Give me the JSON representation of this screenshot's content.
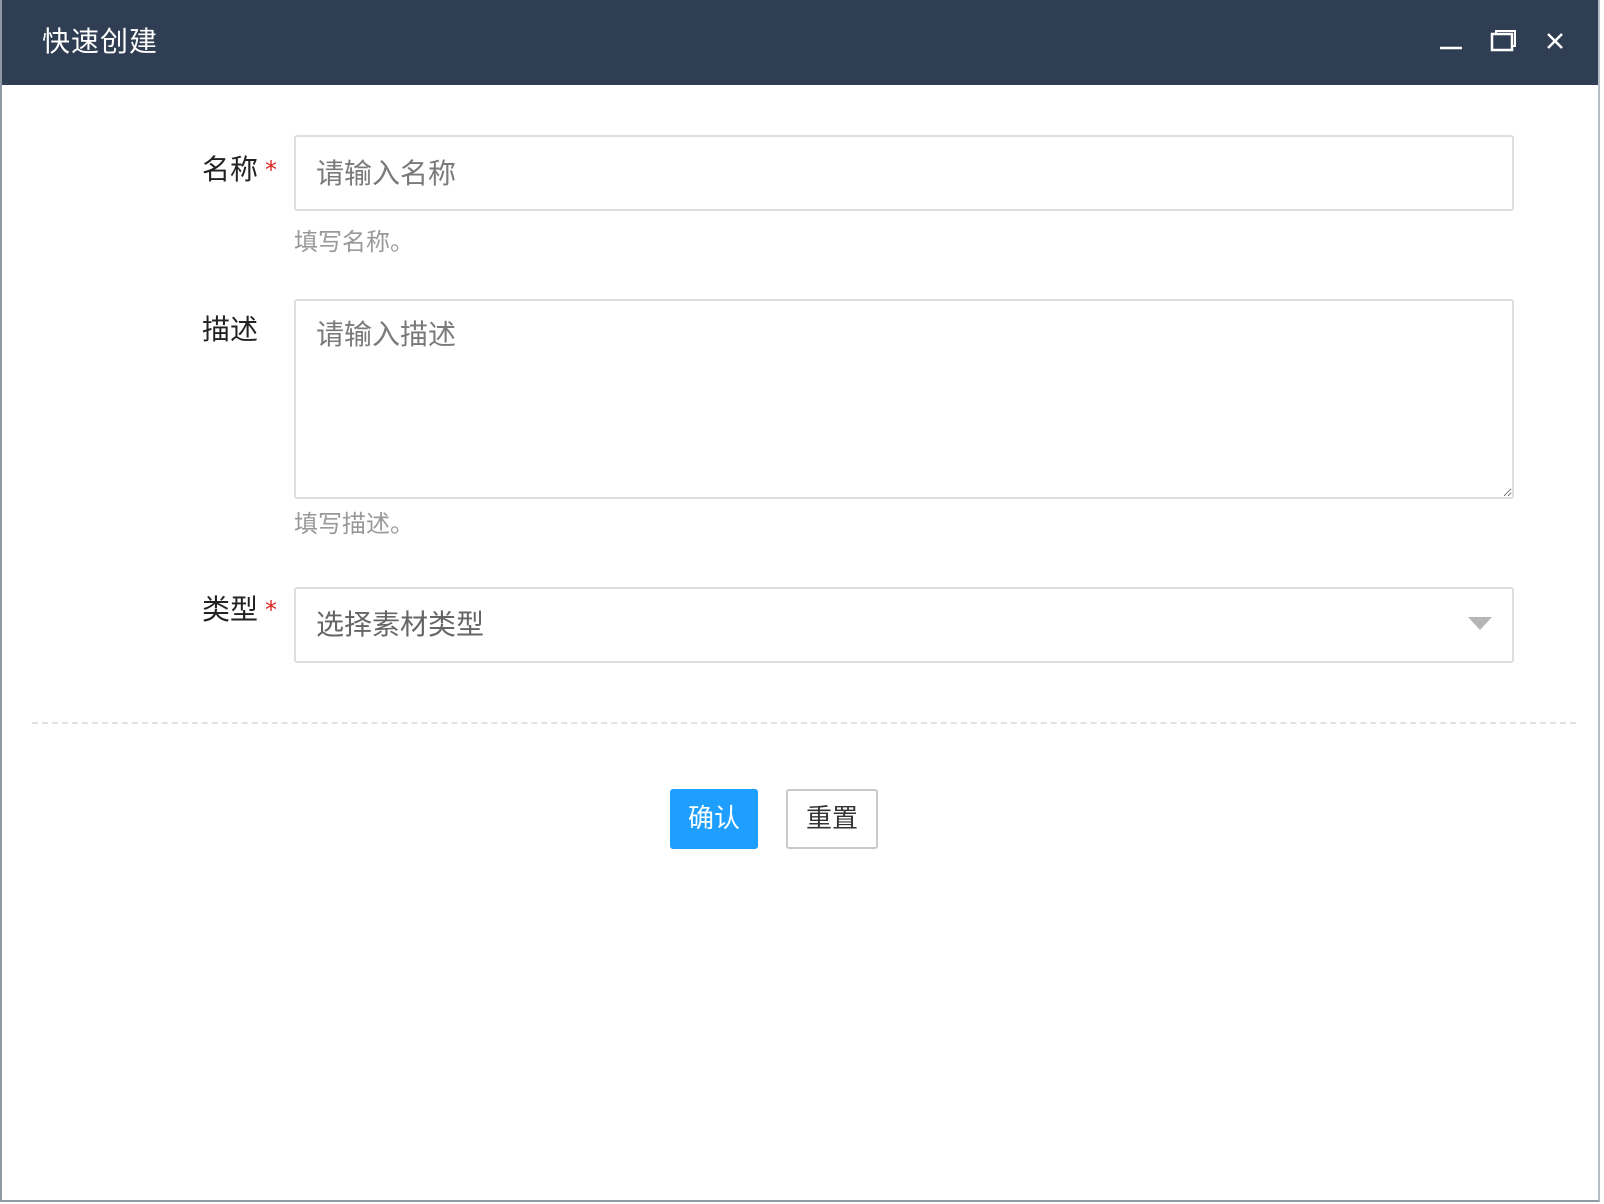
{
  "dialog": {
    "title": "快速创建",
    "controls": {
      "minimize_icon": "minimize-icon",
      "maximize_icon": "maximize-icon",
      "close_icon": "close-icon"
    }
  },
  "form": {
    "name": {
      "label": "名称",
      "required_mark": "*",
      "placeholder": "请输入名称",
      "value": "",
      "hint": "填写名称。"
    },
    "description": {
      "label": "描述",
      "placeholder": "请输入描述",
      "value": "",
      "hint": "填写描述。"
    },
    "type": {
      "label": "类型",
      "required_mark": "*",
      "selected": "选择素材类型",
      "arrow_icon": "chevron-down-icon"
    }
  },
  "actions": {
    "confirm_label": "确认",
    "reset_label": "重置"
  },
  "colors": {
    "titlebar_bg": "#2f3e52",
    "primary": "#1e9fff",
    "required": "#e02424"
  }
}
